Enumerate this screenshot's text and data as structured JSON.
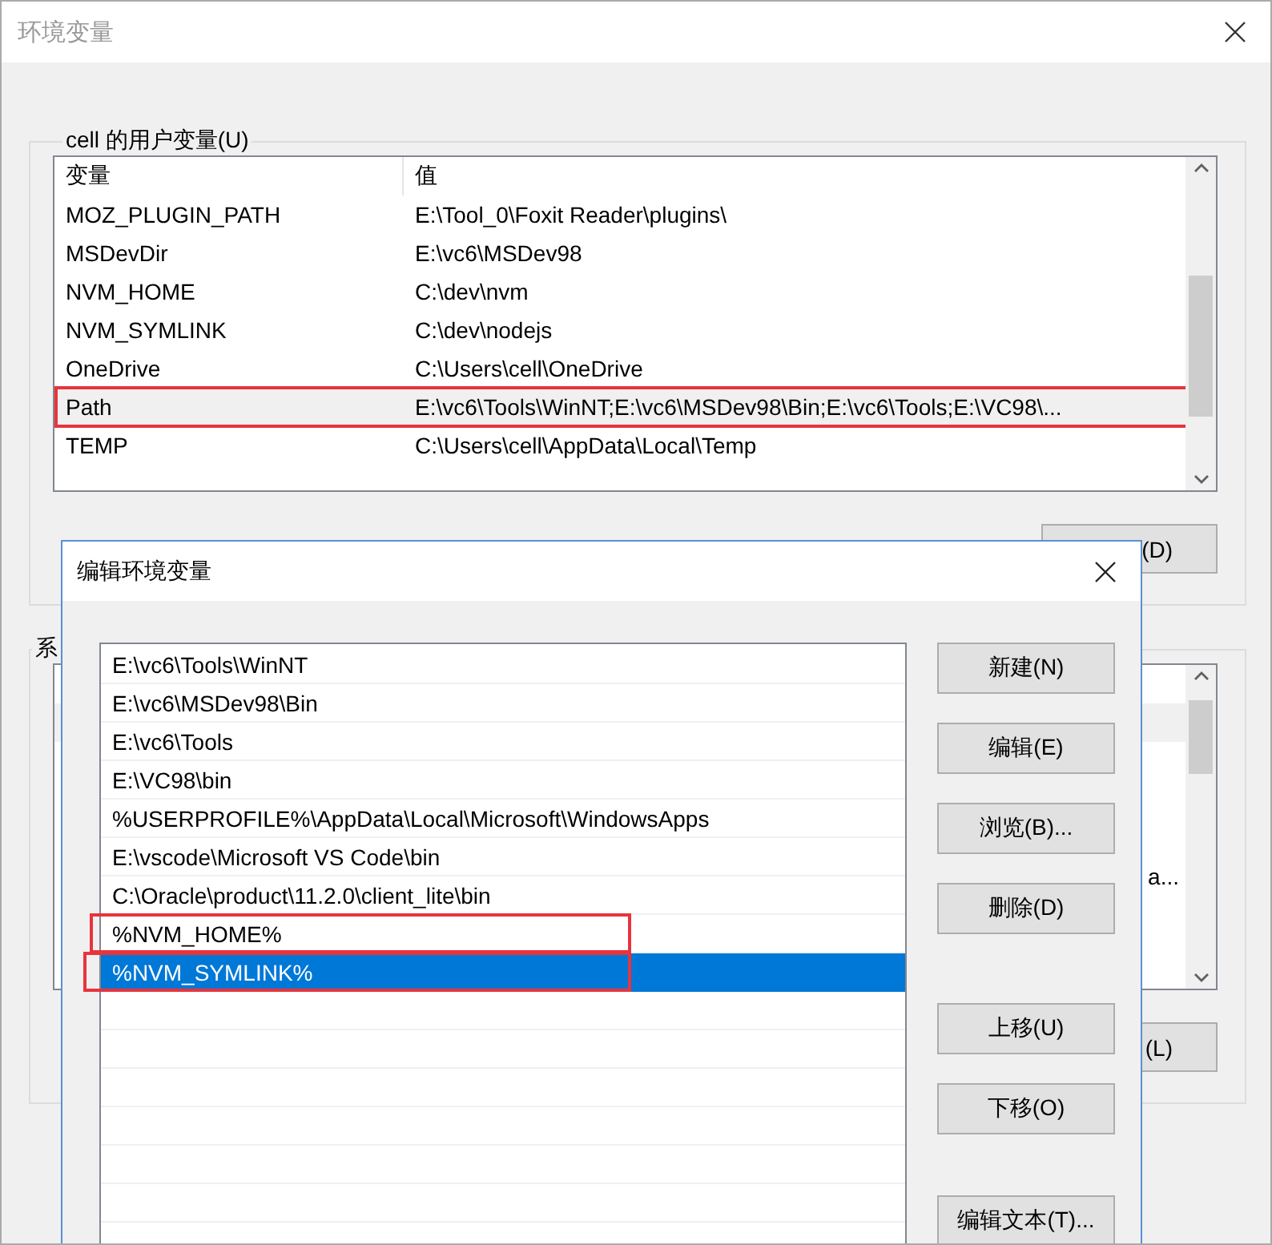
{
  "window": {
    "title": "环境变量"
  },
  "user_vars": {
    "label": "cell 的用户变量(U)",
    "columns": [
      "变量",
      "值"
    ],
    "rows": [
      {
        "name": "MOZ_PLUGIN_PATH",
        "value": "E:\\Tool_0\\Foxit Reader\\plugins\\",
        "selected": false,
        "annotated": false
      },
      {
        "name": "MSDevDir",
        "value": "E:\\vc6\\MSDev98",
        "selected": false,
        "annotated": false
      },
      {
        "name": "NVM_HOME",
        "value": "C:\\dev\\nvm",
        "selected": false,
        "annotated": false
      },
      {
        "name": "NVM_SYMLINK",
        "value": "C:\\dev\\nodejs",
        "selected": false,
        "annotated": false
      },
      {
        "name": "OneDrive",
        "value": "C:\\Users\\cell\\OneDrive",
        "selected": false,
        "annotated": false
      },
      {
        "name": "Path",
        "value": "E:\\vc6\\Tools\\WinNT;E:\\vc6\\MSDev98\\Bin;E:\\vc6\\Tools;E:\\VC98\\...",
        "selected": true,
        "annotated": true
      },
      {
        "name": "TEMP",
        "value": "C:\\Users\\cell\\AppData\\Local\\Temp",
        "selected": false,
        "annotated": false
      }
    ],
    "button": "(D)"
  },
  "system_vars": {
    "label": "系",
    "rows": [
      {
        "selected": false
      },
      {
        "selected": true
      },
      {
        "selected": false
      },
      {
        "selected": false
      },
      {
        "selected": false
      },
      {
        "selected": false,
        "value": "a..."
      }
    ],
    "button": "(L)"
  },
  "edit_dialog": {
    "title": "编辑环境变量",
    "entries": [
      {
        "text": "E:\\vc6\\Tools\\WinNT",
        "selected": false,
        "annotated": false
      },
      {
        "text": "E:\\vc6\\MSDev98\\Bin",
        "selected": false,
        "annotated": false
      },
      {
        "text": "E:\\vc6\\Tools",
        "selected": false,
        "annotated": false
      },
      {
        "text": "E:\\VC98\\bin",
        "selected": false,
        "annotated": false
      },
      {
        "text": "%USERPROFILE%\\AppData\\Local\\Microsoft\\WindowsApps",
        "selected": false,
        "annotated": false
      },
      {
        "text": "E:\\vscode\\Microsoft VS Code\\bin",
        "selected": false,
        "annotated": false
      },
      {
        "text": "C:\\Oracle\\product\\11.2.0\\client_lite\\bin",
        "selected": false,
        "annotated": false
      },
      {
        "text": "%NVM_HOME%",
        "selected": false,
        "annotated": true
      },
      {
        "text": "%NVM_SYMLINK%",
        "selected": true,
        "annotated": true
      }
    ],
    "buttons": [
      {
        "label": "新建(N)"
      },
      {
        "label": "编辑(E)"
      },
      {
        "label": "浏览(B)..."
      },
      {
        "label": "删除(D)"
      },
      {
        "label": "上移(U)"
      },
      {
        "label": "下移(O)"
      },
      {
        "label": "编辑文本(T)..."
      }
    ]
  }
}
